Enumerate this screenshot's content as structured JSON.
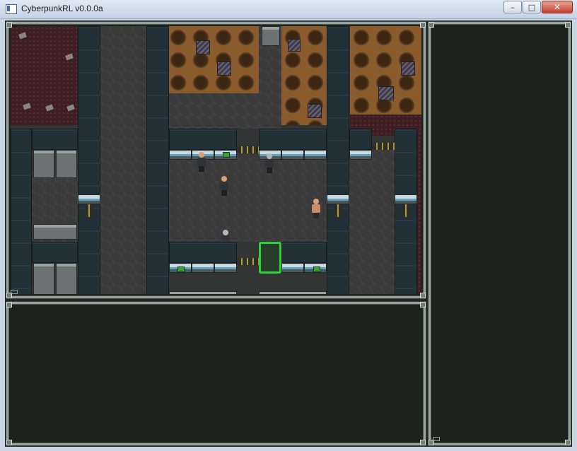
{
  "window": {
    "title": "CyberpunkRL v0.0.0a",
    "minimize_glyph": "–",
    "maximize_glyph": "□",
    "close_glyph": "✕"
  },
  "panels": {
    "map": {
      "name": "map-view"
    },
    "messages": {
      "name": "message-log",
      "lines": []
    },
    "sidebar": {
      "name": "character-sidebar",
      "lines": []
    }
  },
  "map_entities": [
    {
      "kind": "human-enemy",
      "label": "armed thug"
    },
    {
      "kind": "human-enemy",
      "label": "armed thug"
    },
    {
      "kind": "human-enemy",
      "label": "gangster"
    },
    {
      "kind": "player",
      "label": "shirtless brawler"
    },
    {
      "kind": "corpse",
      "label": "fallen body"
    }
  ],
  "colors": {
    "cursor": "#2ed33a",
    "panel_border": "#9aa5a0",
    "panel_bg": "#1c231c",
    "wall": "#223038",
    "floor": "#3a3a3b",
    "dirt": "#8a5c2d",
    "rock": "#3d1e22"
  }
}
